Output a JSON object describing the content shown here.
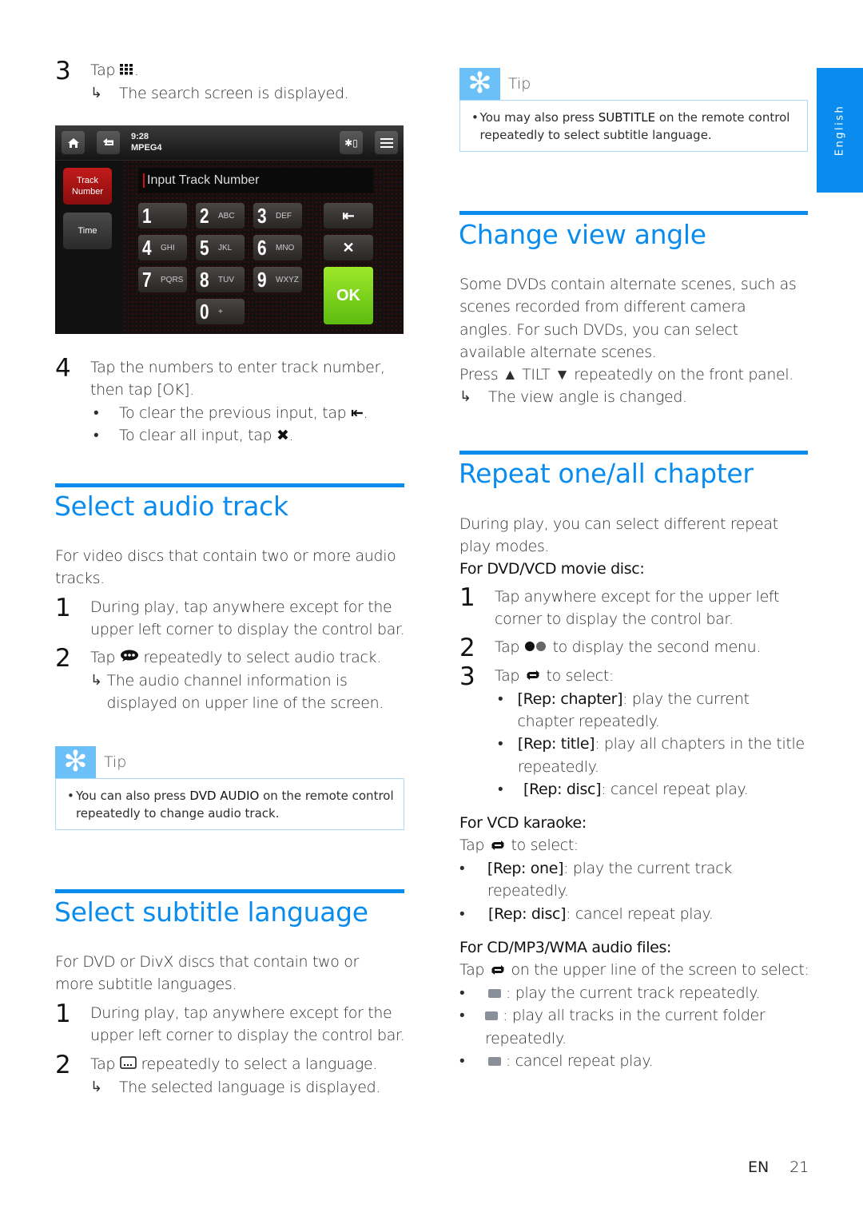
{
  "left": {
    "step3": {
      "num": "3",
      "text_before": "Tap ",
      "icon": "grid-icon",
      "text_after": ".",
      "result": "The search screen is displayed."
    },
    "device": {
      "time": "9:28",
      "format": "MPEG4",
      "side_buttons": [
        "Track Number",
        "Time"
      ],
      "input_placeholder": "Input Track Number",
      "keys": [
        {
          "n": "1",
          "l": ""
        },
        {
          "n": "2",
          "l": "ABC"
        },
        {
          "n": "3",
          "l": "DEF"
        },
        {
          "n": "4",
          "l": "GHI"
        },
        {
          "n": "5",
          "l": "JKL"
        },
        {
          "n": "6",
          "l": "MNO"
        },
        {
          "n": "7",
          "l": "PQRS"
        },
        {
          "n": "8",
          "l": "TUV"
        },
        {
          "n": "9",
          "l": "WXYZ"
        },
        {
          "n": "0",
          "l": "+"
        }
      ],
      "backspace_glyph": "⇤",
      "clear_glyph": "✕",
      "ok_label": "OK"
    },
    "step4": {
      "num": "4",
      "line1": "Tap the numbers to enter track number,",
      "line2": "then tap [OK].",
      "bullets": [
        {
          "text": "To clear the previous input, tap ",
          "icon": "backspace-icon",
          "glyph": "⇤",
          "end": "."
        },
        {
          "text": "To clear all input, tap ",
          "icon": "clear-icon",
          "glyph": "✖",
          "end": "."
        }
      ]
    },
    "audio": {
      "title": "Select audio track",
      "intro": "For video discs that contain two or more audio tracks.",
      "step1_num": "1",
      "step1": "During play, tap anywhere except for the upper left corner to display the control bar.",
      "step2_num": "2",
      "step2_before": "Tap ",
      "step2_after": " repeatedly to select audio track.",
      "step2_result": "The audio channel information is displayed on upper line of the screen.",
      "tip_label": "Tip",
      "tip_before": "You can also press ",
      "tip_bold": "DVD AUDIO",
      "tip_after": " on the remote control repeatedly to change audio track."
    },
    "subtitle": {
      "title": "Select subtitle language",
      "intro": "For DVD or DivX discs that contain two or more subtitle languages.",
      "step1_num": "1",
      "step1": "During play, tap anywhere except for the upper left corner to display the control bar.",
      "step2_num": "2",
      "step2_before": "Tap ",
      "step2_after": " repeatedly to select a language.",
      "step2_result": "The selected language is displayed."
    }
  },
  "right": {
    "tip": {
      "label": "Tip",
      "before": "You may also press ",
      "bold": "SUBTITLE",
      "after": " on the remote control repeatedly to select subtitle language."
    },
    "angle": {
      "title": "Change view angle",
      "intro": "Some DVDs contain alternate scenes, such as scenes recorded from different camera angles. For such DVDs, you can select available alternate scenes.",
      "press": "Press ▲ TILT ▼ repeatedly on the front panel.",
      "result": "The view angle is changed."
    },
    "repeat": {
      "title": "Repeat one/all chapter",
      "intro": "During play, you can select different repeat play modes.",
      "dvd_heading": "For DVD/VCD movie disc:",
      "step1_num": "1",
      "step1": "Tap anywhere except for the upper left corner to display the control bar.",
      "step2_num": "2",
      "step2_before": "Tap ",
      "step2_after": " to display the second menu.",
      "step3_num": "3",
      "step3_before": "Tap ",
      "step3_after": " to select:",
      "dvd_options": [
        {
          "bold": "[Rep: chapter]",
          "text": ": play the current chapter repeatedly."
        },
        {
          "bold": "[Rep: title]",
          "text": ": play all chapters in the title repeatedly."
        },
        {
          "bold": "[Rep: disc]",
          "text": ": cancel repeat play."
        }
      ],
      "vcd_heading": "For VCD karaoke:",
      "vcd_tap_before": "Tap ",
      "vcd_tap_after": " to select:",
      "vcd_options": [
        {
          "bold": "[Rep: one]",
          "text": ": play the current track repeatedly."
        },
        {
          "bold": "[Rep: disc]",
          "text": ": cancel repeat play."
        }
      ],
      "cd_heading": "For CD/MP3/WMA audio files:",
      "cd_tap_before": "Tap ",
      "cd_tap_after": " on the upper line of the screen to select:",
      "cd_options": [
        {
          "icon": "repeat-one-icon",
          "text": ": play the current track repeatedly."
        },
        {
          "icon": "repeat-folder-icon",
          "text": ": play all tracks in the current folder repeatedly."
        },
        {
          "icon": "repeat-off-icon",
          "text": ": cancel repeat play."
        }
      ]
    }
  },
  "lang_tab": "English",
  "footer": {
    "lang": "EN",
    "page": "21"
  },
  "colors": {
    "accent": "#0a8cef",
    "tip_badge": "#6cc0f8",
    "tip_border": "#a9d9fb",
    "ok_green": "#7ad41c",
    "active_red": "#b01515"
  }
}
